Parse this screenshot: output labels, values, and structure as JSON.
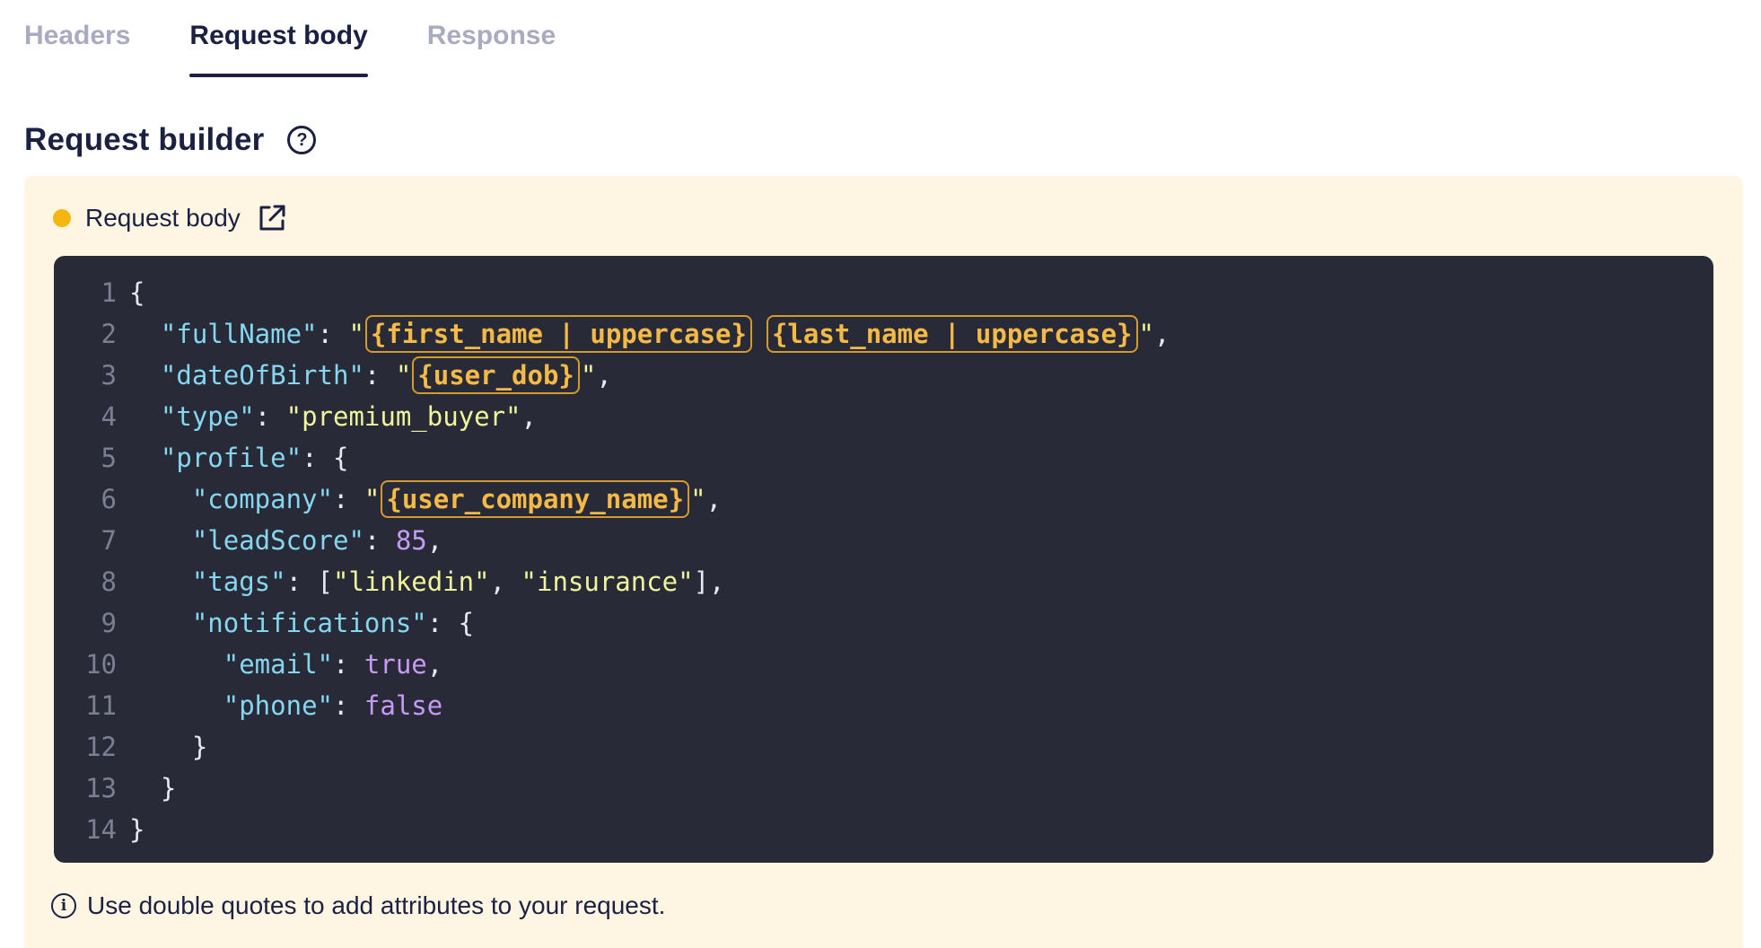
{
  "tabs": [
    {
      "label": "Headers",
      "active": false
    },
    {
      "label": "Request body",
      "active": true
    },
    {
      "label": "Response",
      "active": false
    }
  ],
  "section": {
    "title": "Request builder",
    "help_icon": "question-circle-icon"
  },
  "panel": {
    "status_color": "#f5b70f",
    "label": "Request body",
    "open_icon": "external-link-icon"
  },
  "editor": {
    "lines": [
      {
        "num": "1"
      },
      {
        "num": "2"
      },
      {
        "num": "3"
      },
      {
        "num": "4"
      },
      {
        "num": "5"
      },
      {
        "num": "6"
      },
      {
        "num": "7"
      },
      {
        "num": "8"
      },
      {
        "num": "9"
      },
      {
        "num": "10"
      },
      {
        "num": "11"
      },
      {
        "num": "12"
      },
      {
        "num": "13"
      },
      {
        "num": "14"
      }
    ],
    "tokens": {
      "l1_open": "{",
      "l2_key": "\"fullName\"",
      "l2_var1": "{first_name | uppercase}",
      "l2_var2": "{last_name | uppercase}",
      "l3_key": "\"dateOfBirth\"",
      "l3_var": "{user_dob}",
      "l4_key": "\"type\"",
      "l4_val": "\"premium_buyer\"",
      "l5_key": "\"profile\"",
      "l6_key": "\"company\"",
      "l6_var": "{user_company_name}",
      "l7_key": "\"leadScore\"",
      "l7_val": "85",
      "l8_key": "\"tags\"",
      "l8_val1": "\"linkedin\"",
      "l8_val2": "\"insurance\"",
      "l9_key": "\"notifications\"",
      "l10_key": "\"email\"",
      "l10_val": "true",
      "l11_key": "\"phone\"",
      "l11_val": "false",
      "close": "}"
    },
    "colors": {
      "background": "#282a38",
      "key": "#85d6f0",
      "string": "#f1f59a",
      "literal": "#c69af5",
      "variable": "#f5b945"
    }
  },
  "hint": {
    "icon": "info-circle-icon",
    "text": "Use double quotes to add attributes to your request."
  }
}
